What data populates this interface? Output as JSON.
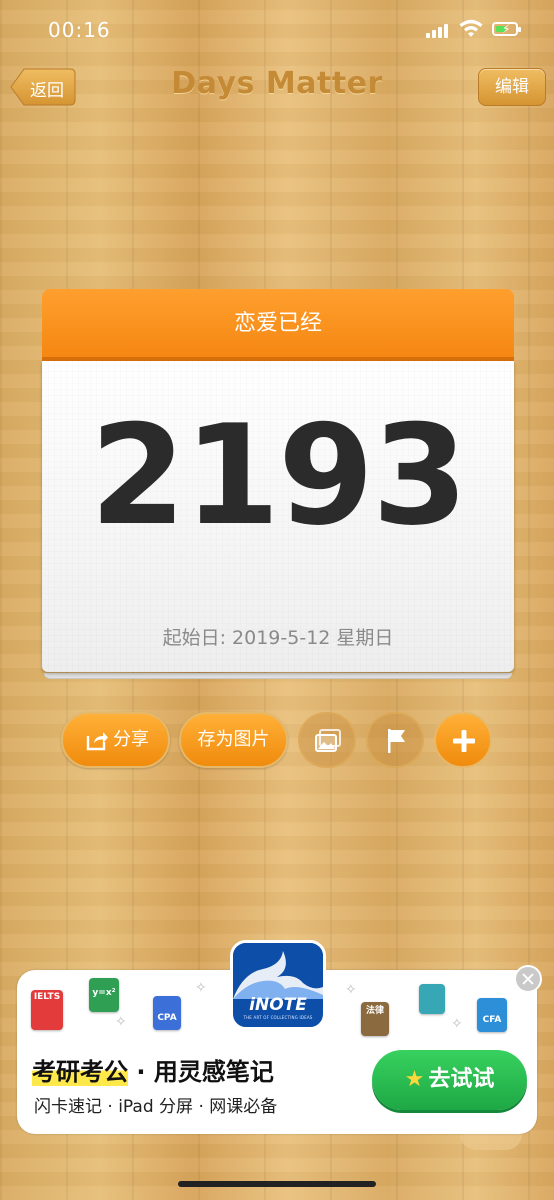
{
  "status_bar": {
    "time": "00:16",
    "battery_color": "#5be05a"
  },
  "nav": {
    "title": "Days Matter",
    "back_label": "返回",
    "edit_label": "编辑"
  },
  "card": {
    "title": "恋爱已经",
    "count": "2193",
    "start_date": "起始日: 2019-5-12 星期日",
    "header_color": "#f58712"
  },
  "actions": {
    "share_label": "分享",
    "save_image_label": "存为图片",
    "icons": [
      "share-icon",
      "photo-icon",
      "flag-icon",
      "plus-icon"
    ]
  },
  "ad": {
    "logo_text": "iNOTE",
    "logo_tagline": "THE ART OF COLLECTING IDEAS",
    "headline_highlight": "考研考公",
    "headline_rest": " · 用灵感笔记",
    "subline": "闪卡速记 · iPad 分屏 · 网课必备",
    "cta_label": "去试试",
    "stickers": [
      "IELTS",
      "y=x²",
      "CPA",
      "法律",
      "CFA"
    ]
  }
}
